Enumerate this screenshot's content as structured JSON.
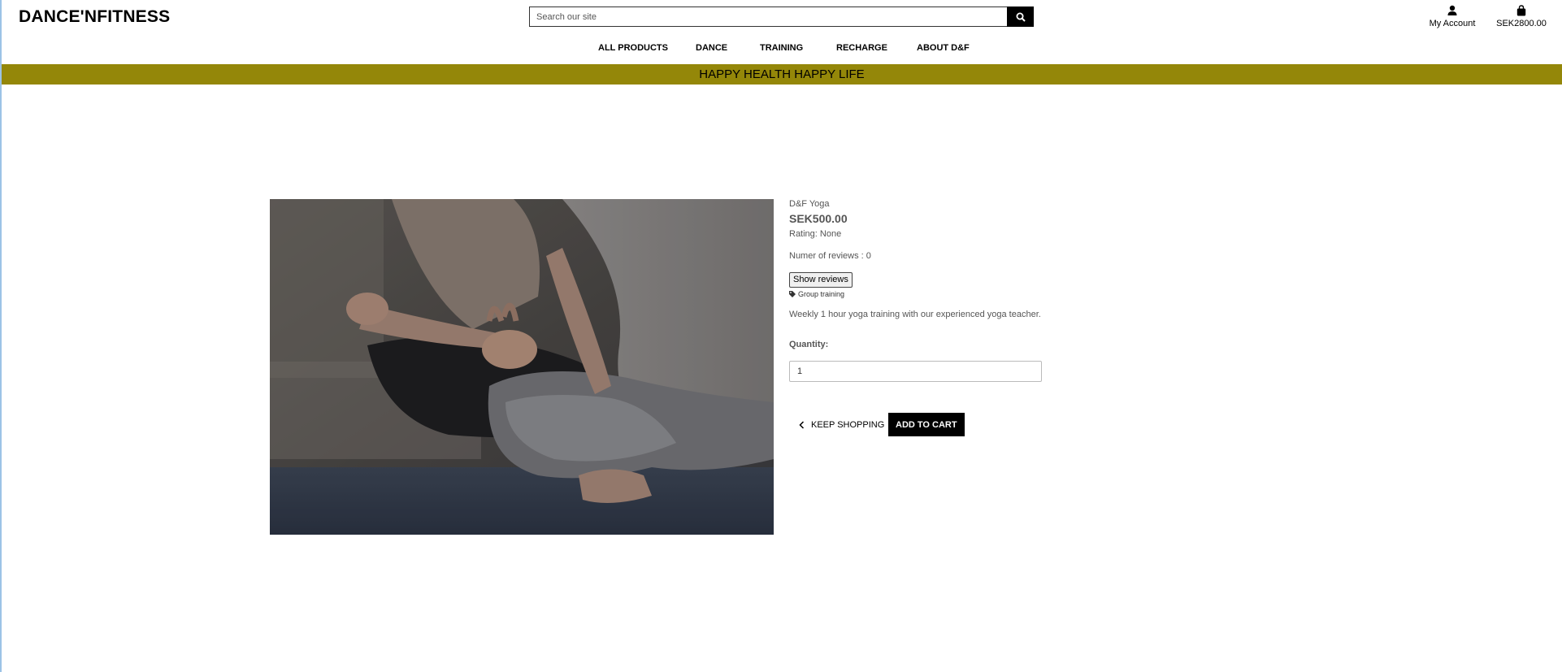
{
  "brand": {
    "logo": "DANCE'NFITNESS"
  },
  "search": {
    "placeholder": "Search our site",
    "icon": "search-icon"
  },
  "account": {
    "label": "My Account",
    "icon": "user-icon"
  },
  "cart": {
    "total": "SEK2800.00",
    "icon": "shopping-bag-icon"
  },
  "nav": {
    "items": [
      {
        "label": "ALL PRODUCTS"
      },
      {
        "label": "DANCE"
      },
      {
        "label": "TRAINING"
      },
      {
        "label": "RECHARGE"
      },
      {
        "label": "ABOUT D&F"
      }
    ]
  },
  "banner": {
    "text": "HAPPY HEALTH HAPPY LIFE",
    "color": "#948709"
  },
  "product": {
    "image": "yoga-photo",
    "name": "D&F Yoga",
    "price": "SEK500.00",
    "rating": "Rating: None",
    "reviews_count": "Numer of reviews : 0",
    "show_reviews_label": "Show reviews",
    "category": "Group training",
    "category_icon": "tag-icon",
    "description": "Weekly 1 hour yoga training with our experienced yoga teacher.",
    "quantity_label": "Quantity:",
    "quantity_value": "1"
  },
  "actions": {
    "keep_shopping": "KEEP SHOPPING",
    "keep_shopping_icon": "chevron-left-icon",
    "add_to_cart": "ADD TO CART"
  }
}
